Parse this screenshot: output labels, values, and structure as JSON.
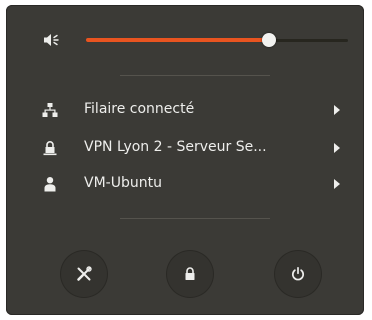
{
  "colors": {
    "menu_bg": "#3b3a36",
    "accent": "#e95420",
    "text": "#eeeeec"
  },
  "volume": {
    "icon": "audio-volume-icon",
    "level_percent": 70
  },
  "menu": {
    "items": [
      {
        "icon": "network-wired-icon",
        "label": "Filaire connecté"
      },
      {
        "icon": "vpn-lock-icon",
        "label": "VPN Lyon 2 - Serveur Se..."
      },
      {
        "icon": "user-icon",
        "label": "VM-Ubuntu"
      }
    ]
  },
  "buttons": [
    {
      "name": "settings-button",
      "icon": "settings-tools-icon"
    },
    {
      "name": "lock-button",
      "icon": "lock-icon"
    },
    {
      "name": "power-button",
      "icon": "power-icon"
    }
  ]
}
